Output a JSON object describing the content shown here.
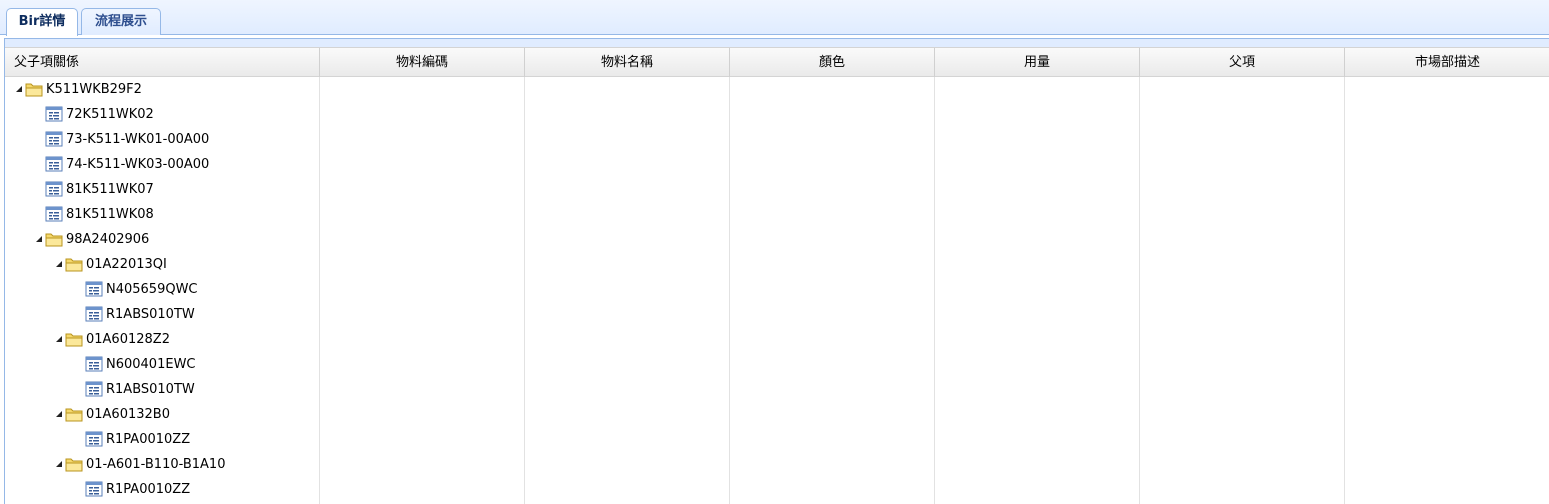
{
  "tabs": [
    {
      "label": "Bir詳情",
      "active": true
    },
    {
      "label": "流程展示",
      "active": false
    }
  ],
  "grid": {
    "columns": [
      "父子項關係",
      "物料編碼",
      "物料名稱",
      "顏色",
      "用量",
      "父項",
      "市場部描述"
    ],
    "tree": [
      {
        "label": "K511WKB29F2",
        "type": "folder",
        "level": 0
      },
      {
        "label": "72K511WK02",
        "type": "leaf",
        "level": 1
      },
      {
        "label": "73-K511-WK01-00A00",
        "type": "leaf",
        "level": 1
      },
      {
        "label": "74-K511-WK03-00A00",
        "type": "leaf",
        "level": 1
      },
      {
        "label": "81K511WK07",
        "type": "leaf",
        "level": 1
      },
      {
        "label": "81K511WK08",
        "type": "leaf",
        "level": 1
      },
      {
        "label": "98A2402906",
        "type": "folder",
        "level": 1
      },
      {
        "label": "01A22013QI",
        "type": "folder",
        "level": 2
      },
      {
        "label": "N405659QWC",
        "type": "leaf",
        "level": 3
      },
      {
        "label": "R1ABS010TW",
        "type": "leaf",
        "level": 3
      },
      {
        "label": "01A60128Z2",
        "type": "folder",
        "level": 2
      },
      {
        "label": "N600401EWC",
        "type": "leaf",
        "level": 3
      },
      {
        "label": "R1ABS010TW",
        "type": "leaf",
        "level": 3
      },
      {
        "label": "01A60132B0",
        "type": "folder",
        "level": 2
      },
      {
        "label": "R1PA0010ZZ",
        "type": "leaf",
        "level": 3
      },
      {
        "label": "01-A601-B110-B1A10",
        "type": "folder",
        "level": 2
      },
      {
        "label": "R1PA0010ZZ",
        "type": "leaf",
        "level": 3
      }
    ]
  },
  "colors": {
    "tab_border": "#95b8e7",
    "tab_text": "#0e2d5f",
    "folder": "#f5d86b",
    "doc_icon": "#5a7fb8"
  }
}
